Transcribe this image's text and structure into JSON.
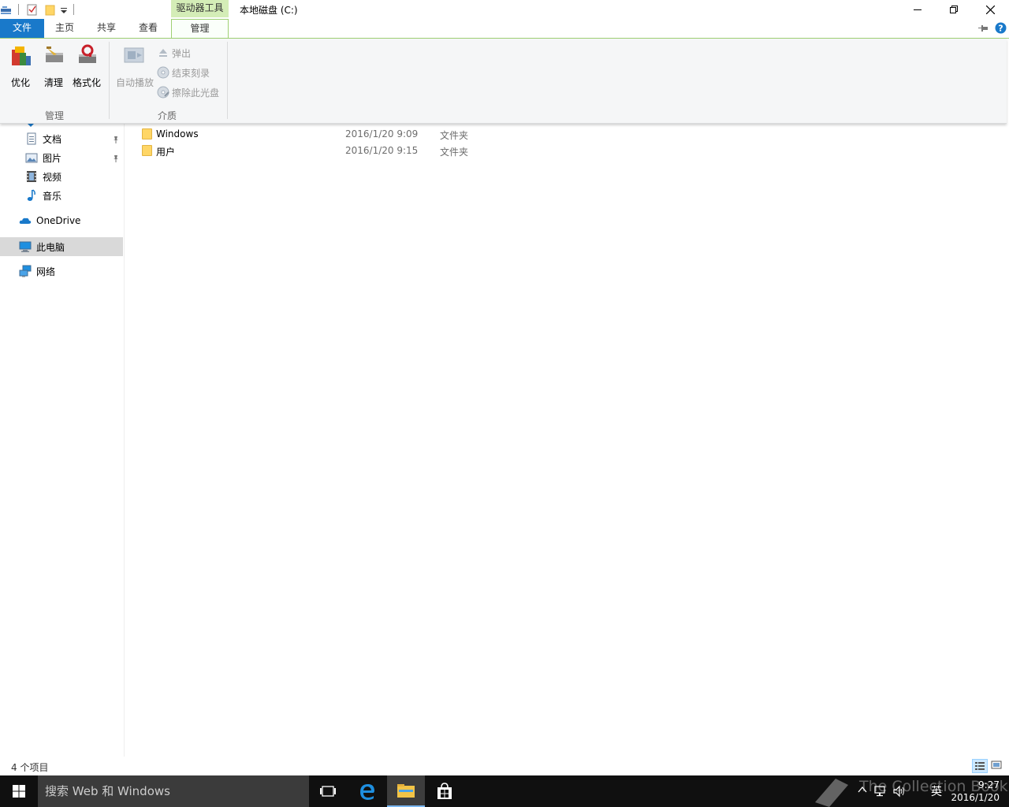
{
  "window": {
    "title": "本地磁盘 (C:)",
    "context_tab_label": "驱动器工具"
  },
  "ribbon": {
    "tabs": [
      "文件",
      "主页",
      "共享",
      "查看",
      "管理"
    ],
    "active_tab": "管理",
    "groups": [
      {
        "label": "管理",
        "buttons": [
          "优化",
          "清理",
          "格式化"
        ]
      },
      {
        "label": "介质",
        "big_button": "自动播放",
        "small_buttons": [
          "弹出",
          "结束刻录",
          "擦除此光盘"
        ]
      }
    ]
  },
  "nav": {
    "items": [
      {
        "label": "文档",
        "icon": "documents-icon",
        "pinned": true
      },
      {
        "label": "图片",
        "icon": "pictures-icon",
        "pinned": true
      },
      {
        "label": "视频",
        "icon": "videos-icon",
        "pinned": false
      },
      {
        "label": "音乐",
        "icon": "music-icon",
        "pinned": false
      },
      {
        "label": "OneDrive",
        "icon": "onedrive-icon",
        "pinned": false
      },
      {
        "label": "此电脑",
        "icon": "this-pc-icon",
        "selected": true
      },
      {
        "label": "网络",
        "icon": "network-icon",
        "pinned": false
      }
    ]
  },
  "files": [
    {
      "name": "Windows",
      "date": "2016/1/20 9:09",
      "type": "文件夹"
    },
    {
      "name": "用户",
      "date": "2016/1/20 9:15",
      "type": "文件夹"
    }
  ],
  "status": {
    "count": "4 个项目"
  },
  "taskbar": {
    "search_placeholder": "搜索 Web 和 Windows",
    "ime": "英",
    "time": "9:27",
    "date": "2016/1/20",
    "watermark": "The Collection Book"
  },
  "colors": {
    "file_tab": "#1979ca",
    "context_tab": "#d4edb7",
    "taskbar": "#101010",
    "folder": "#ffd666"
  }
}
